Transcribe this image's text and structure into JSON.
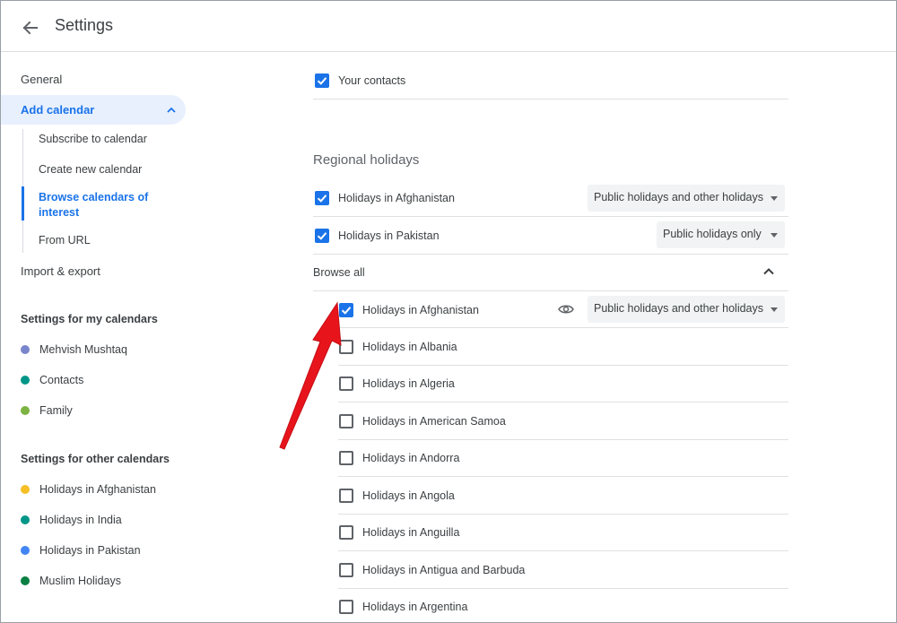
{
  "header": {
    "title": "Settings",
    "back_icon": "arrow-back-icon"
  },
  "sidebar": {
    "general": "General",
    "add_calendar": "Add calendar",
    "sub_items": [
      "Subscribe to calendar",
      "Create new calendar",
      "Browse calendars of interest",
      "From URL"
    ],
    "import_export": "Import & export",
    "my_calendars_heading": "Settings for my calendars",
    "my_calendars": [
      {
        "name": "Mehvish Mushtaq",
        "color": "#7986cb"
      },
      {
        "name": "Contacts",
        "color": "#009688"
      },
      {
        "name": "Family",
        "color": "#7cb342"
      }
    ],
    "other_calendars_heading": "Settings for other calendars",
    "other_calendars": [
      {
        "name": "Holidays in Afghanistan",
        "color": "#f6bf26"
      },
      {
        "name": "Holidays in India",
        "color": "#009688"
      },
      {
        "name": "Holidays in Pakistan",
        "color": "#4285f4"
      },
      {
        "name": "Muslim Holidays",
        "color": "#0b8043"
      }
    ]
  },
  "main": {
    "your_contacts": {
      "label": "Your contacts",
      "checked": true
    },
    "regional_heading": "Regional holidays",
    "regional": [
      {
        "label": "Holidays in Afghanistan",
        "checked": true,
        "select": "Public holidays and other holidays"
      },
      {
        "label": "Holidays in Pakistan",
        "checked": true,
        "select": "Public holidays only"
      }
    ],
    "browse_all": "Browse all",
    "browse_list": [
      {
        "label": "Holidays in Afghanistan",
        "checked": true,
        "select": "Public holidays and other holidays"
      },
      {
        "label": "Holidays in Albania",
        "checked": false
      },
      {
        "label": "Holidays in Algeria",
        "checked": false
      },
      {
        "label": "Holidays in American Samoa",
        "checked": false
      },
      {
        "label": "Holidays in Andorra",
        "checked": false
      },
      {
        "label": "Holidays in Angola",
        "checked": false
      },
      {
        "label": "Holidays in Anguilla",
        "checked": false
      },
      {
        "label": "Holidays in Antigua and Barbuda",
        "checked": false
      },
      {
        "label": "Holidays in Argentina",
        "checked": false
      }
    ]
  },
  "colors": {
    "accent": "#1a73e8",
    "annotation_arrow": "#e8141c"
  }
}
